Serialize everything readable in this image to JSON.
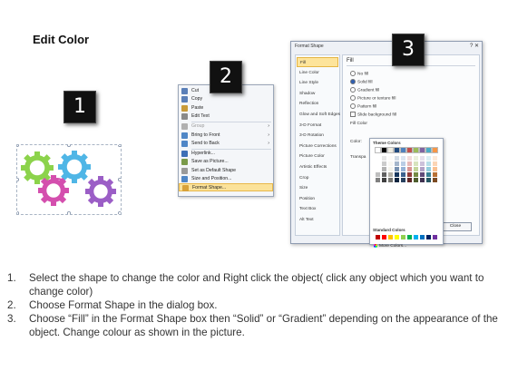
{
  "title": "Edit Color",
  "badges": [
    "1",
    "2",
    "3"
  ],
  "gears": {
    "colors": [
      "#8cd34b",
      "#4fb6e6",
      "#d44fae",
      "#9b5ec6"
    ]
  },
  "context_menu": {
    "items": [
      {
        "label": "Cut",
        "icon": "scissors-icon",
        "icon_color": "#5a7fb8",
        "disabled": false
      },
      {
        "label": "Copy",
        "icon": "copy-icon",
        "icon_color": "#5a7fb8",
        "disabled": false
      },
      {
        "label": "Paste",
        "icon": "paste-icon",
        "icon_color": "#c99b3a",
        "disabled": false
      },
      {
        "label": "Edit Text",
        "icon": "text-icon",
        "icon_color": "#8a8a8a",
        "disabled": false
      },
      {
        "label": "Group",
        "icon": "group-icon",
        "icon_color": "#b0b0b0",
        "disabled": true,
        "submenu": true
      },
      {
        "label": "Bring to Front",
        "icon": "bring-front-icon",
        "icon_color": "#4f86c6",
        "disabled": false,
        "submenu": true
      },
      {
        "label": "Send to Back",
        "icon": "send-back-icon",
        "icon_color": "#4f86c6",
        "disabled": false,
        "submenu": true
      },
      {
        "label": "Hyperlink...",
        "icon": "hyperlink-icon",
        "icon_color": "#3d6fb6",
        "disabled": false
      },
      {
        "label": "Save as Picture...",
        "icon": "picture-icon",
        "icon_color": "#7a9a4a",
        "disabled": false
      },
      {
        "label": "Set as Default Shape",
        "icon": "default-shape-icon",
        "icon_color": "#9a9a9a",
        "disabled": false
      },
      {
        "label": "Size and Position...",
        "icon": "size-icon",
        "icon_color": "#4f86c6",
        "disabled": false
      },
      {
        "label": "Format Shape...",
        "icon": "format-shape-icon",
        "icon_color": "#d8a23a",
        "disabled": false,
        "highlighted": true
      }
    ]
  },
  "dialog": {
    "title": "Format Shape",
    "close_x": "?  ✕",
    "nav": [
      "Fill",
      "Line Color",
      "Line Style",
      "Shadow",
      "Reflection",
      "Glow and Soft Edges",
      "3-D Format",
      "3-D Rotation",
      "Picture Corrections",
      "Picture Color",
      "Artistic Effects",
      "Crop",
      "Size",
      "Position",
      "Text Box",
      "Alt Text"
    ],
    "fill_heading": "Fill",
    "options": [
      "No fill",
      "Solid fill",
      "Gradient fill",
      "Picture or texture fill",
      "Pattern fill",
      "Slide background fill"
    ],
    "selected_option": "Solid fill",
    "fill_color_label": "Fill Color",
    "color_label": "Color:",
    "transparency_label": "Transpa",
    "theme_colors_label": "Theme Colors",
    "standard_colors_label": "Standard Colors",
    "more_colors_label": "More Colors...",
    "close_button": "Close",
    "theme_top": [
      "#ffffff",
      "#000000",
      "#eeece1",
      "#1f497d",
      "#4f81bd",
      "#c0504d",
      "#9bbb59",
      "#8064a2",
      "#4bacc6",
      "#f79646"
    ],
    "standard": [
      "#c00000",
      "#ff0000",
      "#ffc000",
      "#ffff00",
      "#92d050",
      "#00b050",
      "#00b0f0",
      "#0070c0",
      "#002060",
      "#7030a0"
    ]
  },
  "steps": [
    {
      "num": "1.",
      "text": "Select the shape to change the color and Right click the object( click any object which you want to change color)"
    },
    {
      "num": "2.",
      "text": "Choose Format Shape in the dialog box."
    },
    {
      "num": "3.",
      "text": "Choose “Fill” in the Format Shape box then “Solid” or “Gradient” depending on the appearance of the object. Change colour as shown in the picture."
    }
  ]
}
